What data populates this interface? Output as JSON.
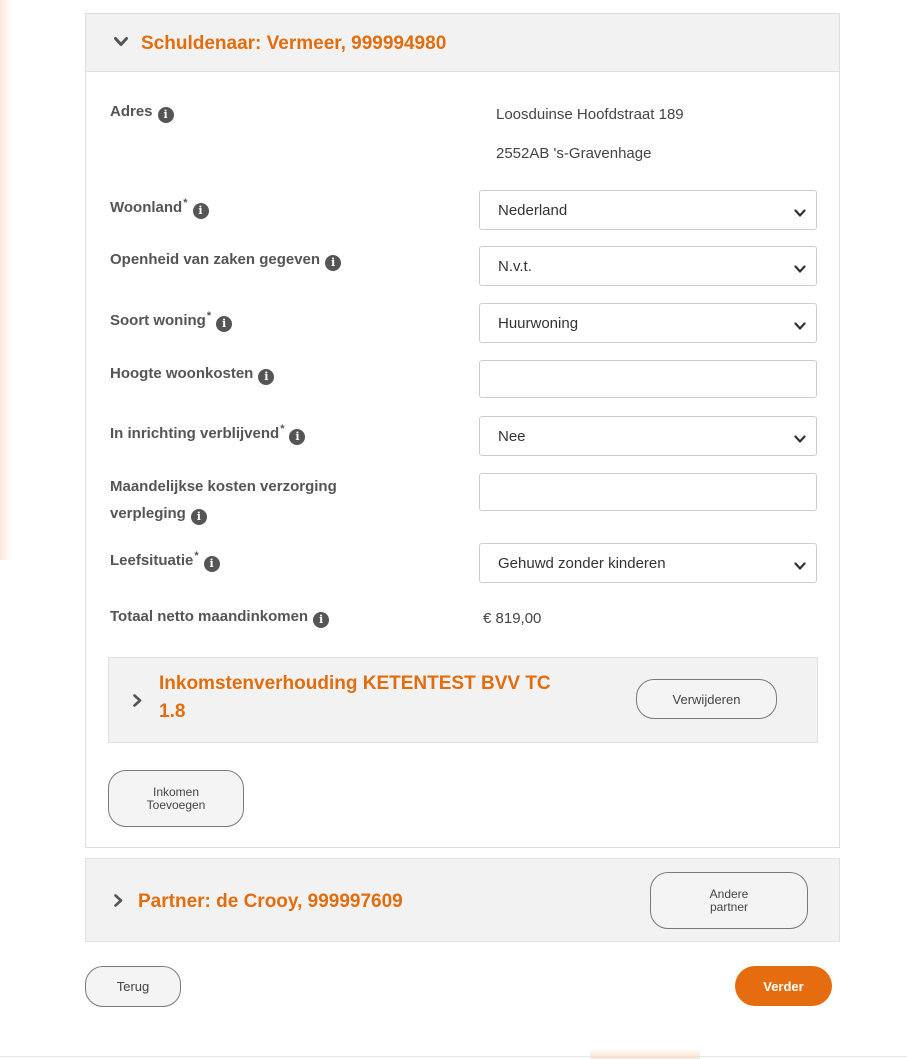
{
  "debtor": {
    "title": "Schuldenaar: Vermeer, 999994980",
    "address_label": "Adres",
    "address_line1": "Loosduinse Hoofdstraat 189",
    "address_line2": "2552AB 's-Gravenhage",
    "country_label": "Woonland",
    "country_value": "Nederland",
    "disclosure_label": "Openheid van zaken gegeven",
    "disclosure_value": "N.v.t.",
    "housing_type_label": "Soort woning",
    "housing_type_value": "Huurwoning",
    "housing_cost_label": "Hoogte woonkosten",
    "housing_cost_value": "",
    "institution_label": "In inrichting verblijvend",
    "institution_value": "Nee",
    "care_cost_label_line1": "Maandelijkse kosten verzorging",
    "care_cost_label_line2": "verpleging",
    "care_cost_value": "",
    "life_situation_label": "Leefsituatie",
    "life_situation_value": "Gehuwd zonder kinderen",
    "total_income_label": "Totaal netto maandinkomen",
    "total_income_value": "€ 819,00",
    "required_marker": "*"
  },
  "income_relation": {
    "title_line1": "Inkomstenverhouding KETENTEST BVV TC",
    "title_line2": "1.8",
    "remove_label": "Verwijderen"
  },
  "add_income": {
    "label_line1": "Inkomen",
    "label_line2": "Toevoegen"
  },
  "partner": {
    "title": "Partner: de Crooy, 999997609",
    "other_partner_line1": "Andere",
    "other_partner_line2": "partner"
  },
  "navigation": {
    "back_label": "Terug",
    "next_label": "Verder"
  },
  "colors": {
    "accent": "#e26d0e",
    "button_primary": "#e56d0f",
    "panel_header": "#f2f2f2"
  },
  "icons": {
    "info": "info-circle-icon",
    "expanded": "chevron-down-icon",
    "collapsed": "chevron-right-icon",
    "select": "chevron-down-icon"
  }
}
